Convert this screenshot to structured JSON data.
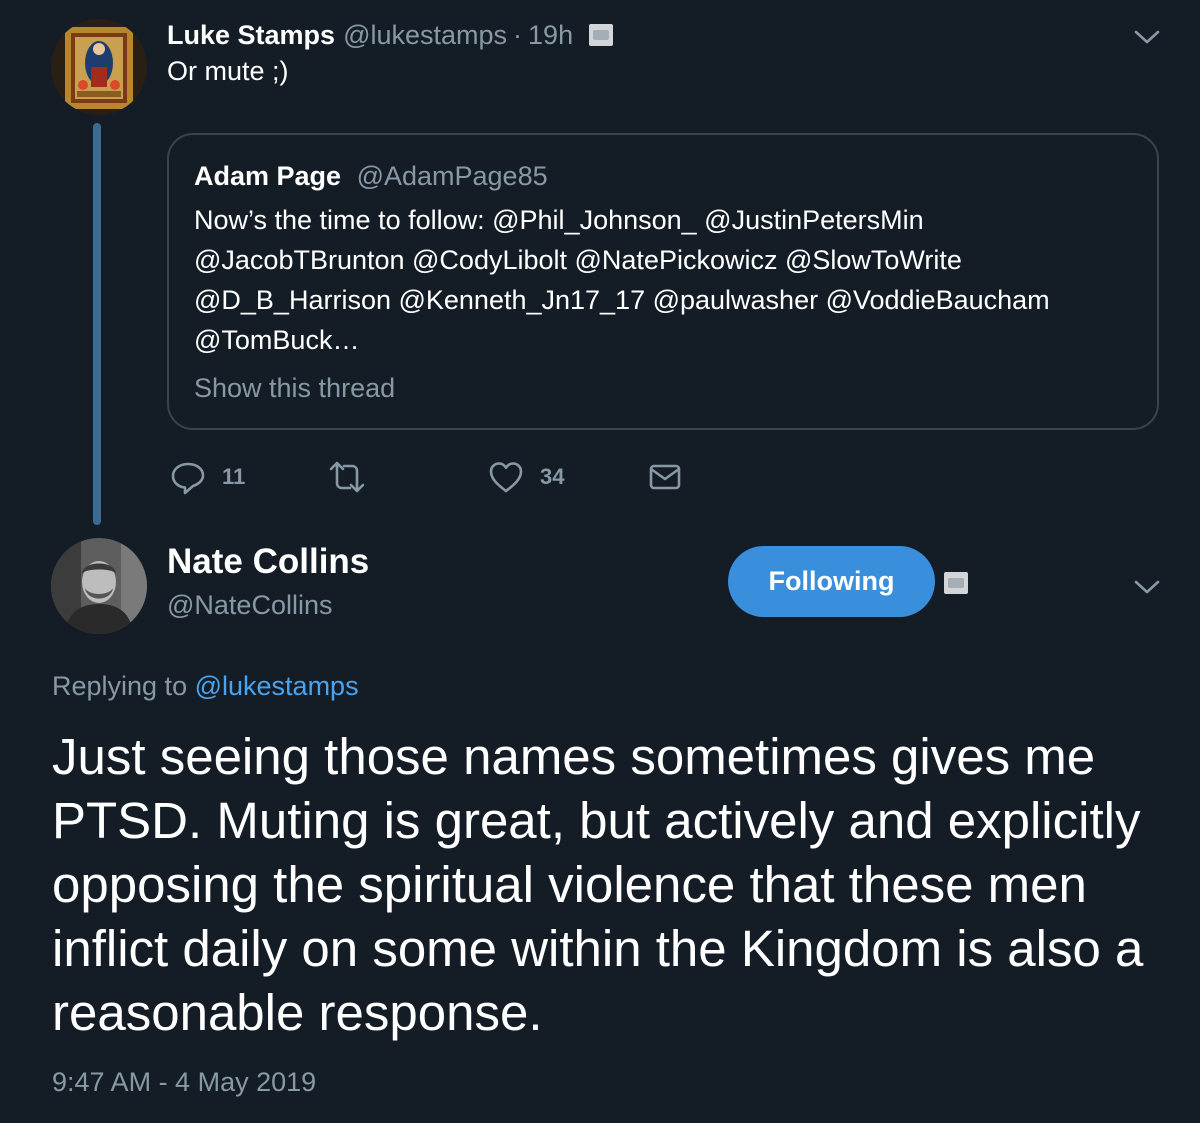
{
  "tweet1": {
    "author_name": "Luke Stamps",
    "handle": "@lukestamps",
    "separator": "·",
    "time": "19h",
    "text": "Or mute ;)",
    "quote": {
      "author_name": "Adam Page",
      "handle": "@AdamPage85",
      "lines": [
        "Now’s the time to follow: @Phil_Johnson_  @JustinPetersMin",
        "@JacobTBrunton @CodyLibolt @NatePickowicz @SlowToWrite",
        "@D_B_Harrison @Kenneth_Jn17_17 @paulwasher @VoddieBaucham",
        "@TomBuck…"
      ],
      "show_thread": "Show this thread"
    },
    "actions": {
      "reply_count": "11",
      "retweet_count": "",
      "like_count": "34"
    }
  },
  "tweet2": {
    "author_name": "Nate Collins",
    "handle": "@NateCollins",
    "follow_label": "Following",
    "replying_prefix": "Replying to",
    "replying_to": "@lukestamps",
    "text": "Just seeing those names sometimes gives me PTSD. Muting is great, but actively and explicitly opposing the spiritual violence that these men inflict daily on some within the Kingdom is also a reasonable response.",
    "timestamp": "9:47 AM - 4 May 2019"
  },
  "icons": {
    "reply": "reply-icon",
    "retweet": "retweet-icon",
    "like": "like-icon",
    "dm": "direct-message-icon",
    "more": "chevron-down-icon"
  },
  "colors": {
    "background": "#141d26",
    "muted_text": "#8899a6",
    "link": "#4aa3ef",
    "follow_button": "#3a8fdc",
    "thread_line": "#3d6a93",
    "border": "#38444d"
  }
}
